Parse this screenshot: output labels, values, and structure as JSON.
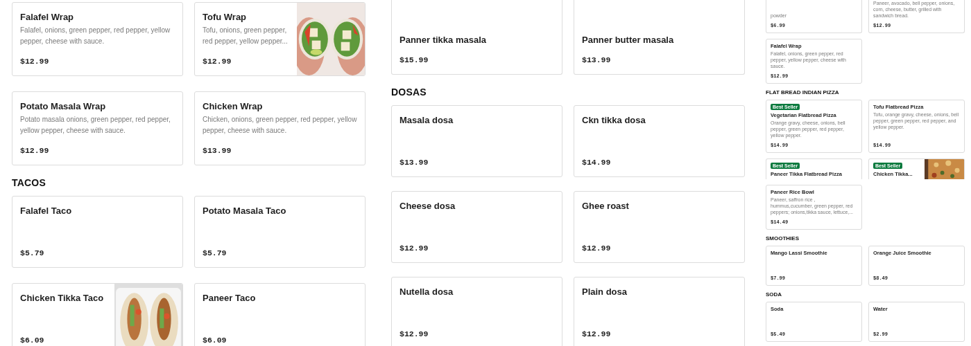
{
  "panels": [
    {
      "sections": [
        {
          "items": [
            {
              "name": "Falafel Wrap",
              "description": "Falafel, onions, green pepper, red pepper, yellow pepper, cheese with sauce.",
              "price": "$12.99"
            },
            {
              "name": "Tofu Wrap",
              "description": "Tofu, onions, green pepper, red pepper, yellow pepper...",
              "price": "$12.99"
            },
            {
              "name": "Potato Masala Wrap",
              "description": "Potato masala onions, green pepper, red pepper, yellow pepper, cheese with sauce.",
              "price": "$12.99"
            },
            {
              "name": "Chicken Wrap",
              "description": "Chicken, onions, green pepper, red pepper, yellow pepper, cheese with sauce.",
              "price": "$13.99"
            }
          ]
        },
        {
          "title": "TACOS",
          "items": [
            {
              "name": "Falafel Taco",
              "price": "$5.79"
            },
            {
              "name": "Potato Masala Taco",
              "price": "$5.79"
            },
            {
              "name": "Chicken Tikka Taco",
              "price": "$6.09"
            },
            {
              "name": "Paneer Taco",
              "price": "$6.09"
            }
          ]
        }
      ]
    },
    {
      "sections": [
        {
          "items": [
            {
              "name": "Panner tikka masala",
              "price": "$15.99",
              "cut_top": true
            },
            {
              "name": "Panner butter masala",
              "price": "$13.99",
              "cut_top": true
            }
          ]
        },
        {
          "title": "DOSAS",
          "items": [
            {
              "name": "Masala dosa",
              "price": "$13.99"
            },
            {
              "name": "Ckn tikka dosa",
              "price": "$14.99"
            },
            {
              "name": "Cheese dosa",
              "price": "$12.99"
            },
            {
              "name": "Ghee roast",
              "price": "$12.99"
            },
            {
              "name": "Nutella dosa",
              "price": "$12.99"
            },
            {
              "name": "Plain dosa",
              "price": "$12.99"
            }
          ]
        }
      ]
    },
    {
      "sections": [
        {
          "items": [
            {
              "description": "powder",
              "price": "$6.99",
              "cut_top": true
            },
            {
              "description": "Paneer, avocado, bell pepper, onions, corn, cheese, butter, grilled with sandwich bread.",
              "price": "$12.99",
              "cut_top": true
            },
            {
              "name": "Falafel Wrap",
              "description": "Falafel, onions, green pepper, red pepper, yellow pepper, cheese with sauce.",
              "price": "$12.99"
            }
          ]
        },
        {
          "title": "FLAT BREAD INDIAN PIZZA",
          "items": [
            {
              "name": "Vegetarian Flatbread Pizza",
              "description": "Orange gravy, cheese, onions, bell pepper, green pepper, red pepper, yellow pepper.",
              "price": "$14.99",
              "best_seller": true,
              "badge": "Best Seller"
            },
            {
              "name": "Tofu Flatbread Pizza",
              "description": "Tofu, orange gravy, cheese, onions, bell pepper, green pepper, red pepper, and yellow pepper.",
              "price": "$14.99",
              "best_seller": false
            },
            {
              "name": "Paneer Tikka Flatbread Pizza",
              "best_seller": true,
              "badge": "Best Seller",
              "cut_bottom": true
            },
            {
              "name": "Chicken Tikka...",
              "best_seller": true,
              "badge": "Best Seller",
              "cut_bottom": true
            },
            {
              "name": "Paneer Rice Bowl",
              "description": "Paneer, saffron rice , hummus,cucumber, green pepper, red peppers; onions,tikka sauce, lettuce,...",
              "price": "$14.49",
              "best_seller": false
            }
          ]
        },
        {
          "title": "SMOOTHIES",
          "items": [
            {
              "name": "Mango Lassi Smoothie",
              "price": "$7.99"
            },
            {
              "name": "Orange Juice Smoothie",
              "price": "$8.49"
            }
          ]
        },
        {
          "title": "SODA",
          "items": [
            {
              "name": "Soda",
              "price": "$5.49"
            },
            {
              "name": "Water",
              "price": "$2.99"
            }
          ]
        }
      ]
    }
  ]
}
